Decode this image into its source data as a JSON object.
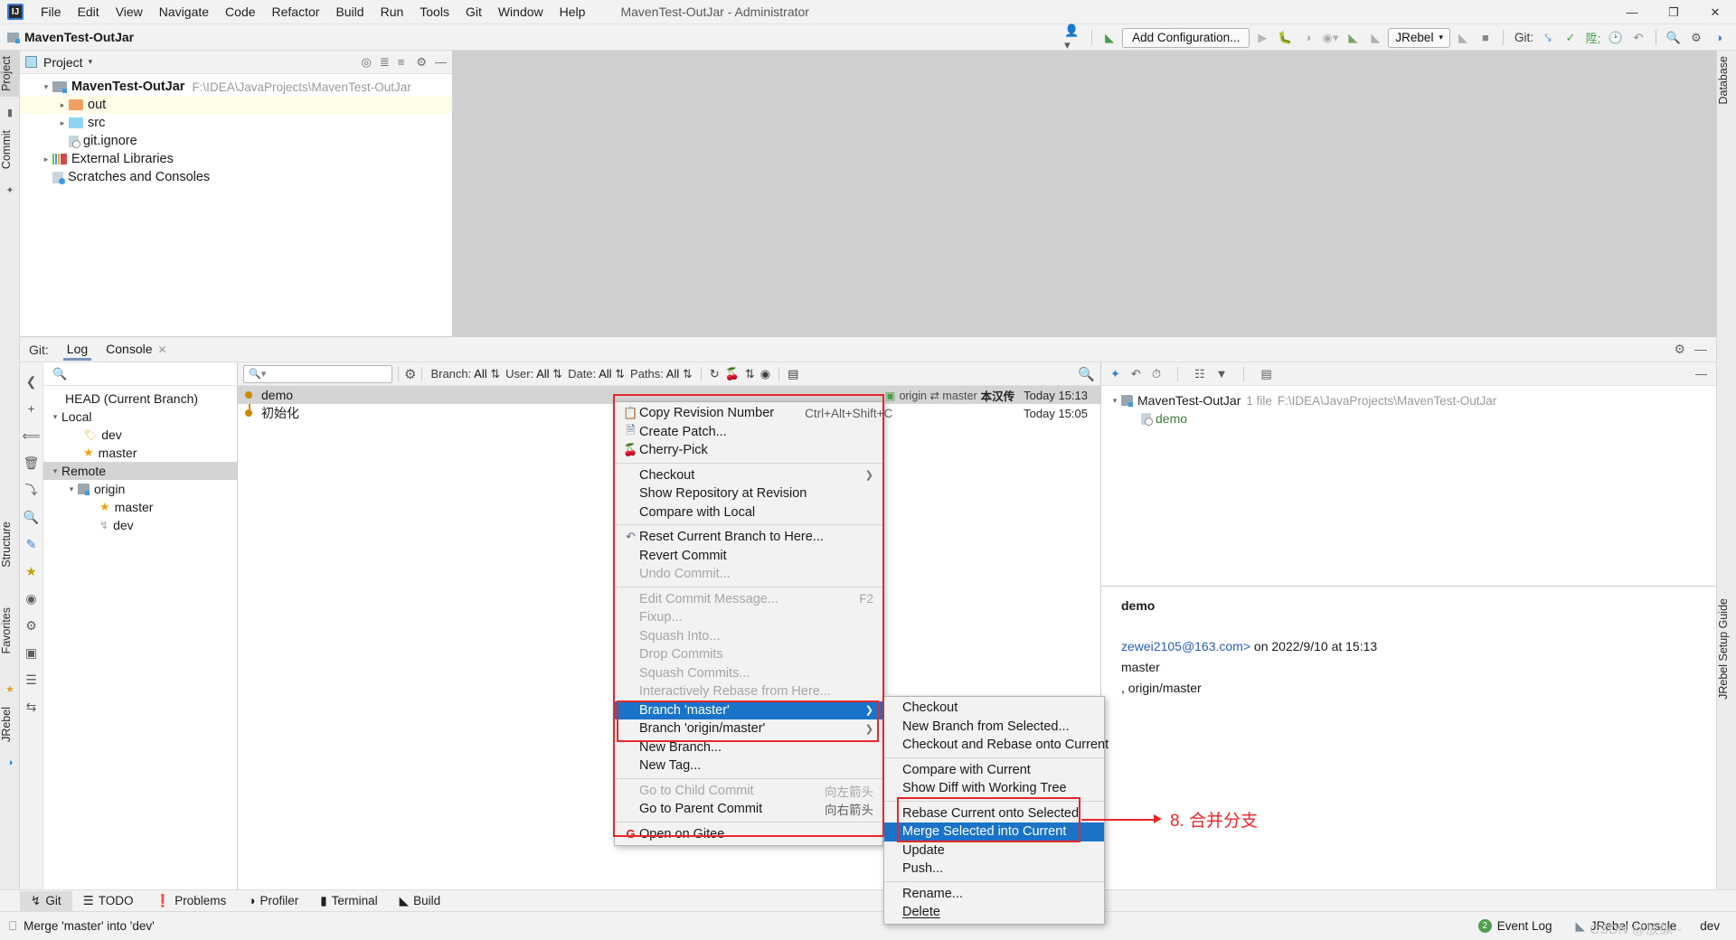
{
  "window": {
    "title": "MavenTest-OutJar - Administrator",
    "project_chip": "MavenTest-OutJar",
    "controls": {
      "minimize": "—",
      "maximize": "❐",
      "close": "✕"
    }
  },
  "menubar": {
    "items": [
      "File",
      "Edit",
      "View",
      "Navigate",
      "Code",
      "Refactor",
      "Build",
      "Run",
      "Tools",
      "Git",
      "Window",
      "Help"
    ]
  },
  "toolbar": {
    "add_configuration": "Add Configuration...",
    "jrebel": "JRebel",
    "git_label": "Git:"
  },
  "left_strip": {
    "tabs": [
      "Project",
      "Commit",
      "Structure",
      "Favorites",
      "JRebel"
    ]
  },
  "right_strip": {
    "tabs": [
      "Database",
      "JRebel Setup Guide"
    ]
  },
  "project_panel": {
    "title": "Project",
    "tree": [
      {
        "label": "MavenTest-OutJar",
        "path": "F:\\IDEA\\JavaProjects\\MavenTest-OutJar",
        "indent": 0,
        "arrow": "open",
        "icon": "module-icon",
        "bold": true,
        "highlight": false
      },
      {
        "label": "out",
        "path": "",
        "indent": 1,
        "arrow": "closed",
        "icon": "folder-orange-icon",
        "bold": false,
        "highlight": true
      },
      {
        "label": "src",
        "path": "",
        "indent": 1,
        "arrow": "closed",
        "icon": "folder-blue-icon",
        "bold": false,
        "highlight": false
      },
      {
        "label": "git.ignore",
        "path": "",
        "indent": 1,
        "arrow": "none",
        "icon": "file-ignored-icon",
        "bold": false,
        "highlight": false
      },
      {
        "label": "External Libraries",
        "path": "",
        "indent": 0,
        "arrow": "closed",
        "icon": "library-icon",
        "bold": false,
        "highlight": false
      },
      {
        "label": "Scratches and Consoles",
        "path": "",
        "indent": 0,
        "arrow": "none",
        "icon": "scratch-icon",
        "bold": false,
        "highlight": false
      }
    ]
  },
  "git_window": {
    "label": "Git:",
    "tabs": [
      {
        "label": "Log",
        "active": true,
        "closable": false
      },
      {
        "label": "Console",
        "active": false,
        "closable": true
      }
    ]
  },
  "branch_pane": {
    "search_placeholder": "",
    "rows": [
      {
        "label": "HEAD (Current Branch)",
        "indent": 1,
        "arrow": "none",
        "icon": "none",
        "selected": false
      },
      {
        "label": "Local",
        "indent": 0,
        "arrow": "open",
        "icon": "none",
        "selected": false
      },
      {
        "label": "dev",
        "indent": 2,
        "arrow": "none",
        "icon": "tag-icon",
        "selected": false
      },
      {
        "label": "master",
        "indent": 2,
        "arrow": "none",
        "icon": "star-icon",
        "selected": false
      },
      {
        "label": "Remote",
        "indent": 0,
        "arrow": "open",
        "icon": "none",
        "selected": true
      },
      {
        "label": "origin",
        "indent": 1,
        "arrow": "open",
        "icon": "folder-grey-icon",
        "selected": false
      },
      {
        "label": "master",
        "indent": 3,
        "arrow": "none",
        "icon": "star-icon",
        "selected": false
      },
      {
        "label": "dev",
        "indent": 3,
        "arrow": "none",
        "icon": "branch-icon",
        "selected": false
      }
    ]
  },
  "log_toolbar": {
    "search_placeholder": "",
    "filters": [
      {
        "name": "Branch:",
        "value": "All"
      },
      {
        "name": "User:",
        "value": "All"
      },
      {
        "name": "Date:",
        "value": "All"
      },
      {
        "name": "Paths:",
        "value": "All"
      }
    ]
  },
  "commits": [
    {
      "message": "demo",
      "ref_labels": "origin ⇄ master",
      "ref_quoted": "本汉传",
      "time": "Today 15:13",
      "selected": true
    },
    {
      "message": "初始化",
      "ref_labels": "",
      "ref_quoted": "",
      "time": "Today 15:05",
      "selected": false
    }
  ],
  "detail_pane": {
    "changed_files": {
      "root": "MavenTest-OutJar",
      "count": "1 file",
      "path": "F:\\IDEA\\JavaProjects\\MavenTest-OutJar",
      "files": [
        {
          "name": "demo"
        }
      ]
    },
    "commit_message": "demo",
    "author_email": "zewei2105@163.com>",
    "author_prefix": "on",
    "date_text": "2022/9/10 at 15:13",
    "in_branch": "master",
    "refs": ", origin/master"
  },
  "context_menu": {
    "items": [
      {
        "label": "Copy Revision Number",
        "accel": "Ctrl+Alt+Shift+C",
        "icon": "copy-icon",
        "disabled": false,
        "submenu": false,
        "selected": false
      },
      {
        "label": "Create Patch...",
        "accel": "",
        "icon": "patch-icon",
        "disabled": false,
        "submenu": false,
        "selected": false
      },
      {
        "label": "Cherry-Pick",
        "accel": "",
        "icon": "cherry-pick-icon",
        "disabled": false,
        "submenu": false,
        "selected": false
      },
      {
        "separator": true
      },
      {
        "label": "Checkout",
        "accel": "",
        "icon": "",
        "disabled": false,
        "submenu": true,
        "selected": false
      },
      {
        "label": "Show Repository at Revision",
        "accel": "",
        "icon": "",
        "disabled": false,
        "submenu": false,
        "selected": false
      },
      {
        "label": "Compare with Local",
        "accel": "",
        "icon": "",
        "disabled": false,
        "submenu": false,
        "selected": false
      },
      {
        "separator": true
      },
      {
        "label": "Reset Current Branch to Here...",
        "accel": "",
        "icon": "undo-icon",
        "disabled": false,
        "submenu": false,
        "selected": false
      },
      {
        "label": "Revert Commit",
        "accel": "",
        "icon": "",
        "disabled": false,
        "submenu": false,
        "selected": false
      },
      {
        "label": "Undo Commit...",
        "accel": "",
        "icon": "",
        "disabled": true,
        "submenu": false,
        "selected": false
      },
      {
        "separator": true
      },
      {
        "label": "Edit Commit Message...",
        "accel": "F2",
        "icon": "",
        "disabled": true,
        "submenu": false,
        "selected": false
      },
      {
        "label": "Fixup...",
        "accel": "",
        "icon": "",
        "disabled": true,
        "submenu": false,
        "selected": false
      },
      {
        "label": "Squash Into...",
        "accel": "",
        "icon": "",
        "disabled": true,
        "submenu": false,
        "selected": false
      },
      {
        "label": "Drop Commits",
        "accel": "",
        "icon": "",
        "disabled": true,
        "submenu": false,
        "selected": false
      },
      {
        "label": "Squash Commits...",
        "accel": "",
        "icon": "",
        "disabled": true,
        "submenu": false,
        "selected": false
      },
      {
        "label": "Interactively Rebase from Here...",
        "accel": "",
        "icon": "",
        "disabled": true,
        "submenu": false,
        "selected": false
      },
      {
        "label": "Branch 'master'",
        "accel": "",
        "icon": "",
        "disabled": false,
        "submenu": true,
        "selected": true
      },
      {
        "label": "Branch 'origin/master'",
        "accel": "",
        "icon": "",
        "disabled": false,
        "submenu": true,
        "selected": false
      },
      {
        "label": "New Branch...",
        "accel": "",
        "icon": "",
        "disabled": false,
        "submenu": false,
        "selected": false
      },
      {
        "label": "New Tag...",
        "accel": "",
        "icon": "",
        "disabled": false,
        "submenu": false,
        "selected": false
      },
      {
        "separator": true
      },
      {
        "label": "Go to Child Commit",
        "accel": "向左箭头",
        "icon": "",
        "disabled": true,
        "submenu": false,
        "selected": false
      },
      {
        "label": "Go to Parent Commit",
        "accel": "向右箭头",
        "icon": "",
        "disabled": false,
        "submenu": false,
        "selected": false
      },
      {
        "separator": true
      },
      {
        "label": "Open on Gitee",
        "accel": "",
        "icon": "gitee-icon",
        "disabled": false,
        "submenu": false,
        "selected": false
      }
    ]
  },
  "submenu": {
    "items": [
      {
        "label": "Checkout",
        "disabled": false,
        "selected": false
      },
      {
        "label": "New Branch from Selected...",
        "disabled": false,
        "selected": false
      },
      {
        "label": "Checkout and Rebase onto Current",
        "disabled": false,
        "selected": false
      },
      {
        "separator": true
      },
      {
        "label": "Compare with Current",
        "disabled": false,
        "selected": false
      },
      {
        "label": "Show Diff with Working Tree",
        "disabled": false,
        "selected": false
      },
      {
        "separator": true
      },
      {
        "label": "Rebase Current onto Selected",
        "disabled": false,
        "selected": false
      },
      {
        "label": "Merge Selected into Current",
        "disabled": false,
        "selected": true
      },
      {
        "label": "Update",
        "disabled": false,
        "selected": false
      },
      {
        "label": "Push...",
        "disabled": false,
        "selected": false
      },
      {
        "separator": true
      },
      {
        "label": "Rename...",
        "disabled": false,
        "selected": false
      },
      {
        "label": "Delete",
        "disabled": false,
        "selected": false
      }
    ]
  },
  "annotation": {
    "text": "8. 合并分支",
    "color": "#e8262a"
  },
  "bottom_tabs": [
    {
      "label": "Git",
      "icon": "branch-icon",
      "active": true
    },
    {
      "label": "TODO",
      "icon": "todo-icon",
      "active": false
    },
    {
      "label": "Problems",
      "icon": "problems-icon",
      "active": false
    },
    {
      "label": "Profiler",
      "icon": "profiler-icon",
      "active": false
    },
    {
      "label": "Terminal",
      "icon": "terminal-icon",
      "active": false
    },
    {
      "label": "Build",
      "icon": "build-icon",
      "active": false
    }
  ],
  "status_bar": {
    "message": "Merge 'master' into 'dev'",
    "event_log": "Event Log",
    "event_count": "2",
    "jrebel_console": "JRebel Console",
    "branch": "dev",
    "watermark": "CSDN @放纵--"
  }
}
